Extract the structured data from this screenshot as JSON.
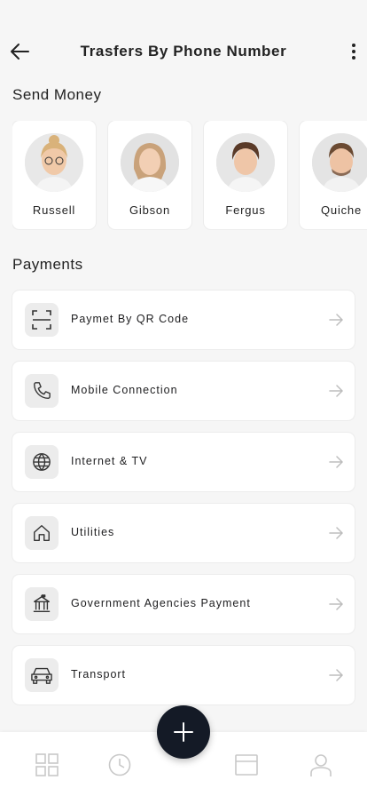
{
  "header": {
    "title": "Trasfers By Phone Number",
    "back_icon": "arrow-left-icon",
    "more_icon": "more-vertical-icon"
  },
  "send_money": {
    "title": "Send Money",
    "contacts": [
      {
        "name": "Russell",
        "avatar": "avatar-russell"
      },
      {
        "name": "Gibson",
        "avatar": "avatar-gibson"
      },
      {
        "name": "Fergus",
        "avatar": "avatar-fergus"
      },
      {
        "name": "Quiche",
        "avatar": "avatar-quiche"
      }
    ]
  },
  "payments": {
    "title": "Payments",
    "items": [
      {
        "label": "Paymet By QR Code",
        "icon": "qr-scan-icon"
      },
      {
        "label": "Mobile Connection",
        "icon": "phone-icon"
      },
      {
        "label": "Internet & TV",
        "icon": "globe-icon"
      },
      {
        "label": "Utilities",
        "icon": "home-icon"
      },
      {
        "label": "Government Agencies Payment",
        "icon": "government-building-icon"
      },
      {
        "label": "Transport",
        "icon": "car-icon"
      }
    ]
  },
  "bottom_nav": {
    "items": [
      "grid-icon",
      "clock-icon",
      "card-icon",
      "user-icon"
    ],
    "fab_icon": "plus-icon"
  },
  "colors": {
    "background": "#f6f6f6",
    "card": "#ffffff",
    "fab": "#141a26"
  }
}
